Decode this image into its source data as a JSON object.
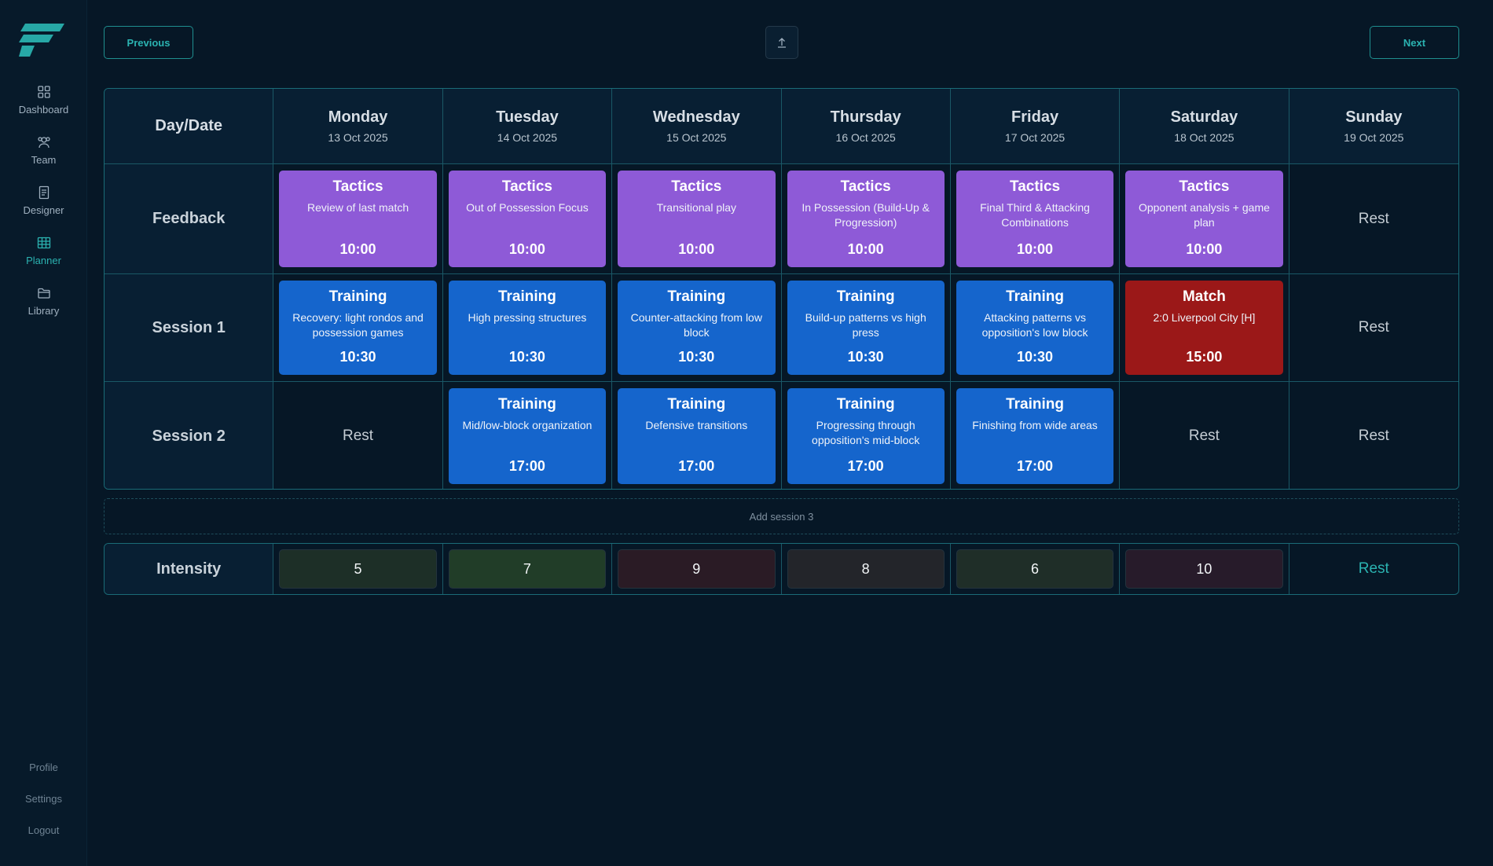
{
  "nav": {
    "items": [
      {
        "label": "Dashboard",
        "icon": "dashboard-icon",
        "active": false
      },
      {
        "label": "Team",
        "icon": "team-icon",
        "active": false
      },
      {
        "label": "Designer",
        "icon": "designer-icon",
        "active": false
      },
      {
        "label": "Planner",
        "icon": "planner-icon",
        "active": true
      },
      {
        "label": "Library",
        "icon": "library-icon",
        "active": false
      }
    ],
    "bottom": [
      "Profile",
      "Settings",
      "Logout"
    ]
  },
  "toolbar": {
    "previous_label": "Previous",
    "next_label": "Next",
    "upload_icon": "upload-icon"
  },
  "grid": {
    "corner_label": "Day/Date",
    "days": [
      {
        "name": "Monday",
        "date": "13 Oct 2025"
      },
      {
        "name": "Tuesday",
        "date": "14 Oct 2025"
      },
      {
        "name": "Wednesday",
        "date": "15 Oct 2025"
      },
      {
        "name": "Thursday",
        "date": "16 Oct 2025"
      },
      {
        "name": "Friday",
        "date": "17 Oct 2025"
      },
      {
        "name": "Saturday",
        "date": "18 Oct 2025"
      },
      {
        "name": "Sunday",
        "date": "19 Oct 2025"
      }
    ],
    "rows": [
      {
        "label": "Feedback",
        "cells": [
          {
            "type": "tactics",
            "title": "Tactics",
            "desc": "Review of last match",
            "time": "10:00"
          },
          {
            "type": "tactics",
            "title": "Tactics",
            "desc": "Out of Possession Focus",
            "time": "10:00"
          },
          {
            "type": "tactics",
            "title": "Tactics",
            "desc": "Transitional play",
            "time": "10:00"
          },
          {
            "type": "tactics",
            "title": "Tactics",
            "desc": "In Possession (Build-Up & Progression)",
            "time": "10:00"
          },
          {
            "type": "tactics",
            "title": "Tactics",
            "desc": "Final Third & Attacking Combinations",
            "time": "10:00"
          },
          {
            "type": "tactics",
            "title": "Tactics",
            "desc": "Opponent analysis + game plan",
            "time": "10:00"
          },
          {
            "type": "rest",
            "text": "Rest"
          }
        ]
      },
      {
        "label": "Session 1",
        "cells": [
          {
            "type": "training",
            "title": "Training",
            "desc": "Recovery: light rondos and possession games",
            "time": "10:30"
          },
          {
            "type": "training",
            "title": "Training",
            "desc": "High pressing structures",
            "time": "10:30"
          },
          {
            "type": "training",
            "title": "Training",
            "desc": "Counter-attacking from low block",
            "time": "10:30"
          },
          {
            "type": "training",
            "title": "Training",
            "desc": "Build-up patterns vs high press",
            "time": "10:30"
          },
          {
            "type": "training",
            "title": "Training",
            "desc": "Attacking patterns vs opposition's low block",
            "time": "10:30"
          },
          {
            "type": "match",
            "title": "Match",
            "desc": "2:0 Liverpool City [H]",
            "time": "15:00"
          },
          {
            "type": "rest",
            "text": "Rest"
          }
        ]
      },
      {
        "label": "Session 2",
        "cells": [
          {
            "type": "rest",
            "text": "Rest"
          },
          {
            "type": "training",
            "title": "Training",
            "desc": "Mid/low-block organization",
            "time": "17:00"
          },
          {
            "type": "training",
            "title": "Training",
            "desc": "Defensive transitions",
            "time": "17:00"
          },
          {
            "type": "training",
            "title": "Training",
            "desc": "Progressing through opposition's mid-block",
            "time": "17:00"
          },
          {
            "type": "training",
            "title": "Training",
            "desc": "Finishing from wide areas",
            "time": "17:00"
          },
          {
            "type": "rest",
            "text": "Rest"
          },
          {
            "type": "rest",
            "text": "Rest"
          }
        ]
      }
    ]
  },
  "add_session_label": "Add session 3",
  "intensity": {
    "label": "Intensity",
    "values": [
      {
        "value": "5",
        "color": "#1d2f27"
      },
      {
        "value": "7",
        "color": "#213d28"
      },
      {
        "value": "9",
        "color": "#2a1b25"
      },
      {
        "value": "8",
        "color": "#23252a"
      },
      {
        "value": "6",
        "color": "#1f2e28"
      },
      {
        "value": "10",
        "color": "#271b2a"
      },
      {
        "value": "Rest",
        "color": ""
      }
    ]
  },
  "colors": {
    "accent": "#2bb3b1",
    "tactics": "#8e5ad7",
    "training": "#1565cc",
    "match": "#9b1818"
  }
}
